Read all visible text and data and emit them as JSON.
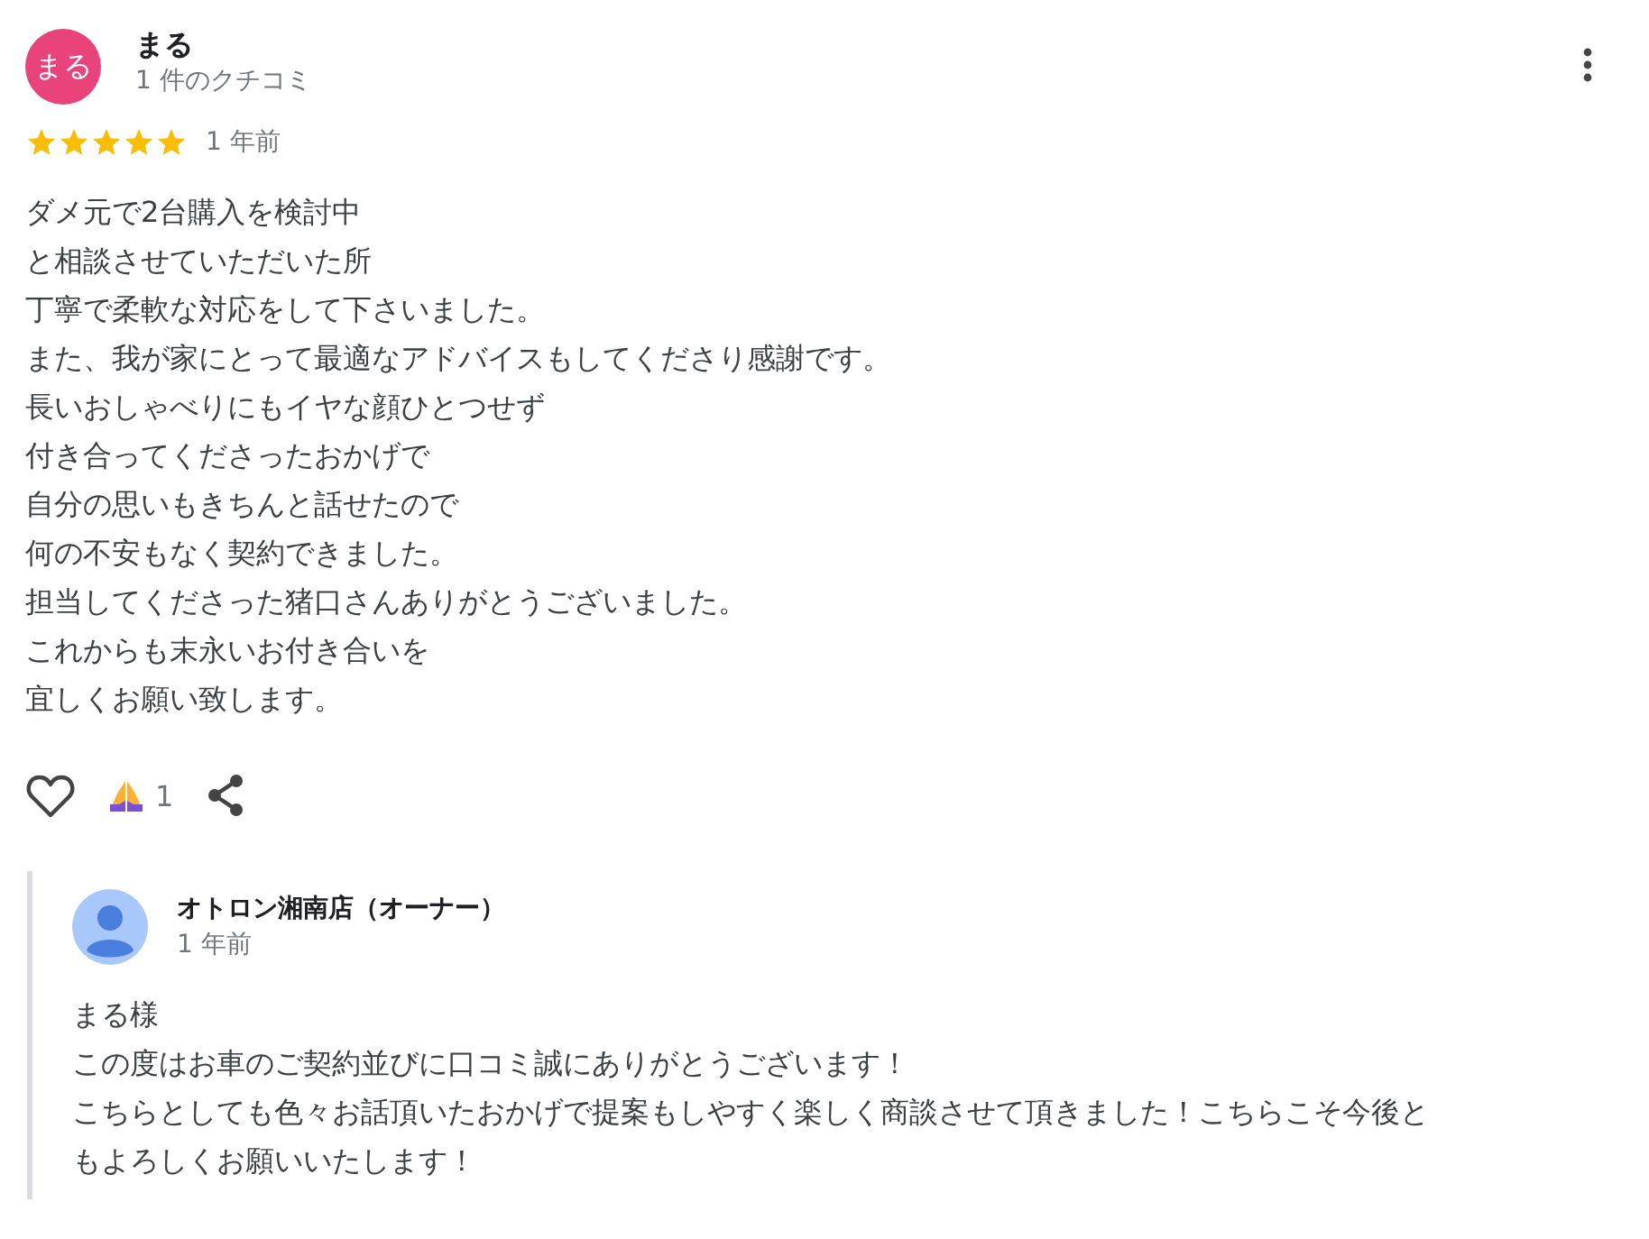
{
  "review": {
    "avatar_text": "まる",
    "name": "まる",
    "subtitle": "1 件のクチコミ",
    "stars": 5,
    "time": "1 年前",
    "lines": [
      "ダメ元で2台購入を検討中",
      "と相談させていただいた所",
      "丁寧で柔軟な対応をして下さいました。",
      "また、我が家にとって最適なアドバイスもしてくださり感謝です。",
      "長いおしゃべりにもイヤな顔ひとつせず",
      "付き合ってくださったおかげで",
      "自分の思いもきちんと話せたので",
      "何の不安もなく契約できました。",
      "担当してくださった猪口さんありがとうございました。",
      "これからも末永いお付き合いを",
      "宜しくお願い致します。"
    ],
    "liked": false,
    "reaction_count": "1"
  },
  "reply": {
    "name": "オトロン湘南店（オーナー）",
    "time": "1 年前",
    "lines": [
      "まる様",
      "この度はお車のご契約並びに口コミ誠にありがとうございます！",
      "こちらとしても色々お話頂いたおかげで提案もしやすく楽しく商談させて頂きました！こちらこそ今後ともよろしくお願いいたします！"
    ]
  }
}
